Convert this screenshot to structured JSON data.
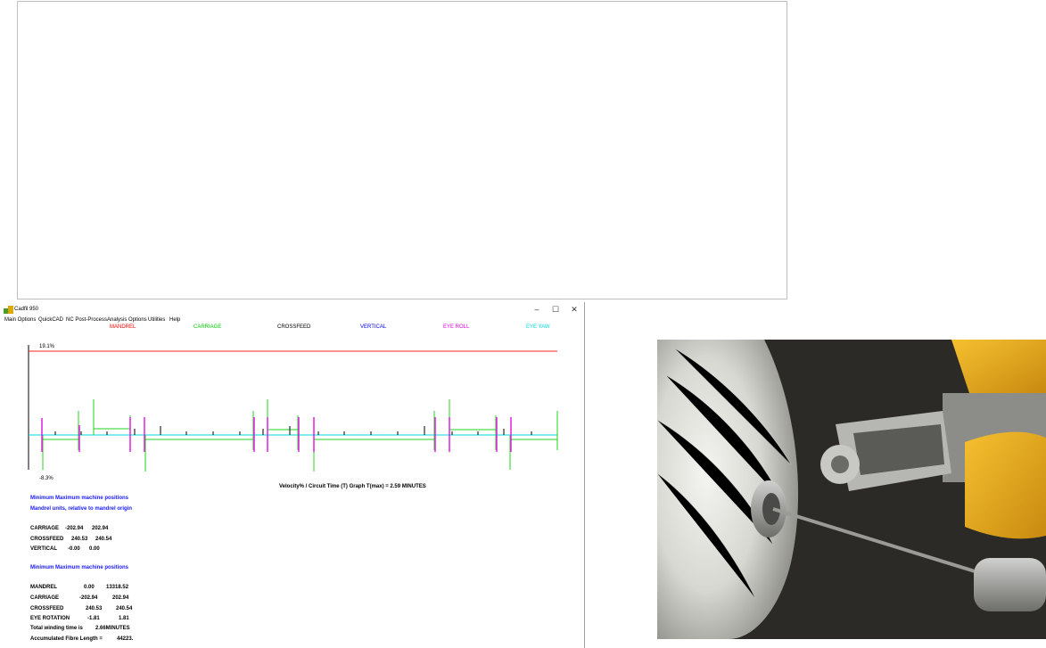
{
  "window": {
    "title": "Cadfil 950",
    "controls": {
      "minimize": "–",
      "maximize": "☐",
      "close": "✕"
    }
  },
  "menu": [
    "Main Options",
    "QuickCAD",
    "NC Post-Process",
    "Analysis Options",
    "Utilities",
    "Help"
  ],
  "legend": [
    {
      "label": "MANDREL",
      "color": "#ff0000"
    },
    {
      "label": "CARRIAGE",
      "color": "#00d000"
    },
    {
      "label": "CROSSFEED",
      "color": "#000000"
    },
    {
      "label": "VERTICAL",
      "color": "#0000ff"
    },
    {
      "label": "EYE ROLL",
      "color": "#e000e0"
    },
    {
      "label": "EYE YAW",
      "color": "#00e0e0"
    }
  ],
  "graph": {
    "max_label": "19.1%",
    "min_label": "-8.3%",
    "caption": "Velocity% / Circuit Time (T) Graph  T(max) =   2.59    MINUTES"
  },
  "positions1": {
    "heading1": "Minimum  Maximum machine positions",
    "heading2": "Mandrel units, relative to mandrel origin",
    "rows": [
      {
        "name": "CARRIAGE",
        "min": "-202.94",
        "max": "202.94"
      },
      {
        "name": "CROSSFEED",
        "min": "240.53",
        "max": "240.54"
      },
      {
        "name": "VERTICAL",
        "min": "-0.00",
        "max": "0.00"
      }
    ]
  },
  "positions2": {
    "heading": "Minimum  Maximum machine positions",
    "rows": [
      {
        "name": "MANDREL",
        "min": "0.00",
        "max": "13318.52"
      },
      {
        "name": "CARRIAGE",
        "min": "-202.94",
        "max": "202.94"
      },
      {
        "name": "CROSSFEED",
        "min": "240.53",
        "max": "240.54"
      },
      {
        "name": "EYE ROTATION",
        "min": "-1.81",
        "max": "1.81"
      }
    ]
  },
  "summary": {
    "winding_time_label": "Total winding time is",
    "winding_time_value": "2.66MINUTES",
    "fibre_length_label": "Accumulated Fibre Length =",
    "fibre_length_value": "44223."
  }
}
